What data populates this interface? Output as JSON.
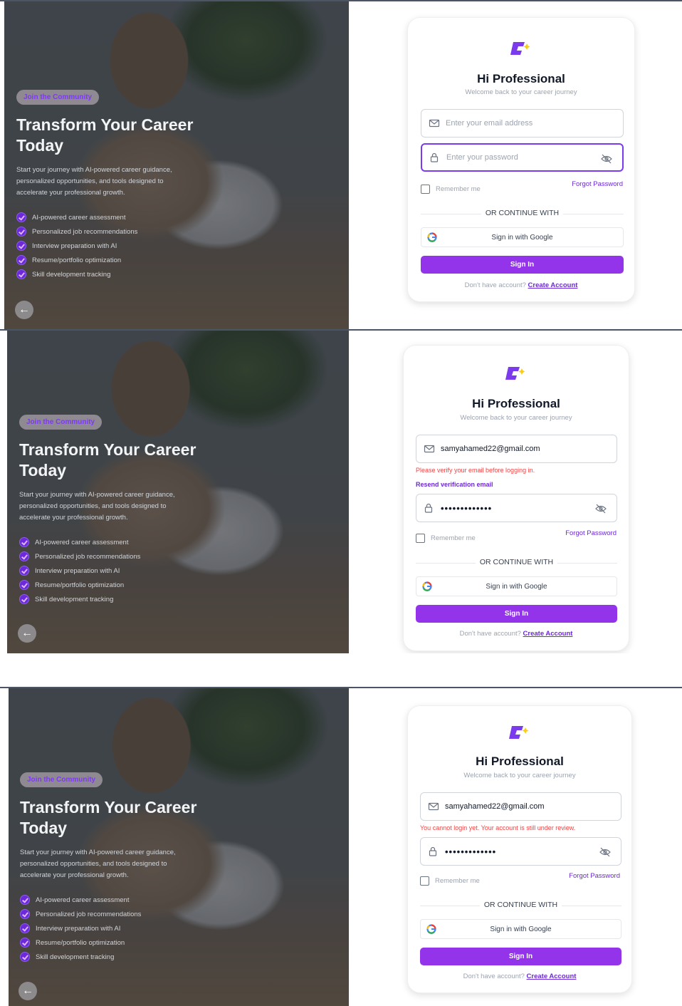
{
  "hero": {
    "badge": "Join the Community",
    "title": "Transform Your Career Today",
    "subtitle": "Start your journey with AI-powered career guidance, personalized opportunities, and tools designed to accelerate your professional growth.",
    "features": [
      "AI-powered career assessment",
      "Personalized job recommendations",
      "Interview preparation with AI",
      "Resume/portfolio optimization",
      "Skill development tracking"
    ],
    "back_icon": "arrow-left-icon"
  },
  "card": {
    "title": "Hi Professional",
    "subtitle": "Welcome back to your career journey",
    "remember_label": "Remember me",
    "forgot_label": "Forgot Password",
    "divider_label": "OR CONTINUE WITH",
    "google_label": "Sign in with Google",
    "signin_label": "Sign In",
    "footer_text": "Don't have account?",
    "footer_link": "Create Account",
    "brand_color": "#9333ea"
  },
  "states": [
    {
      "email_placeholder": "Enter your email address",
      "password_placeholder": "Enter your password"
    },
    {
      "email_value": "samyahamed22@gmail.com",
      "password_value": "•••••••••••••",
      "error": "Please verify your email before logging in.",
      "resend": "Resend verification email"
    },
    {
      "email_value": "samyahamed22@gmail.com",
      "password_value": "•••••••••••••",
      "error": "You cannot login yet. Your account is still under review."
    }
  ]
}
